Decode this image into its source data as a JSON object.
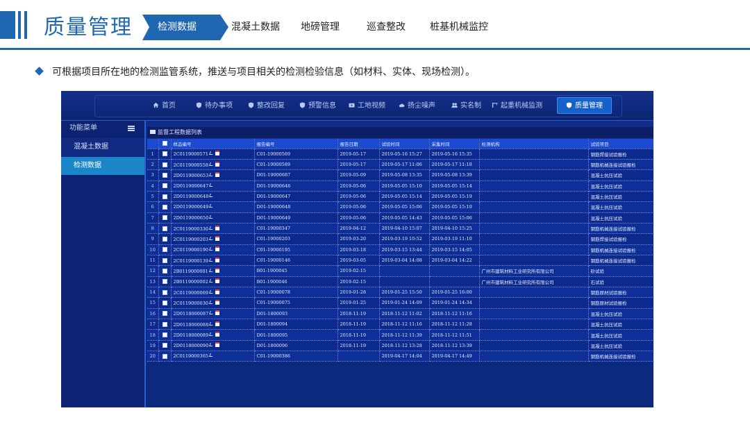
{
  "slide": {
    "title": "质量管理",
    "nav": [
      "检测数据",
      "混凝土数据",
      "地磅管理",
      "巡查整改",
      "桩基机械监控"
    ],
    "bullet": "可根据项目所在地的检测监管系统，推送与项目相关的检测检验信息（如材料、实体、现场检测）。",
    "colors": {
      "brand": "#1f67b1"
    }
  },
  "app": {
    "top_nav": [
      {
        "label": "首页",
        "icon": "home-icon"
      },
      {
        "label": "待办事项",
        "icon": "shield-icon"
      },
      {
        "label": "整改回复",
        "icon": "shield-icon"
      },
      {
        "label": "预警信息",
        "icon": "shield-icon"
      },
      {
        "label": "工地视频",
        "icon": "video-icon"
      },
      {
        "label": "扬尘噪声",
        "icon": "cloud-icon"
      },
      {
        "label": "实名制",
        "icon": "people-icon"
      },
      {
        "label": "起重机械监测",
        "icon": "crane-icon"
      },
      {
        "label": "质量管理",
        "icon": "shield-icon"
      }
    ],
    "sidebar": {
      "title": "功能菜单",
      "items": [
        "混凝土数据",
        "检测数据"
      ]
    },
    "grid": {
      "title": "监督工程数据列表",
      "columns": [
        "样品编号",
        "报告编号",
        "报告日期",
        "试验时间",
        "采集时间",
        "检测机构",
        "试验项目"
      ],
      "rows": [
        {
          "num": "1",
          "sample": "2C0119000571",
          "doc": true,
          "report": "C01-19000569",
          "rdate": "2019-05-17",
          "test": "2019-05-16 15:27",
          "collect": "2019-05-16 15:35",
          "org": "",
          "item": "钢筋焊接试验报检"
        },
        {
          "num": "2",
          "sample": "2C0119000558",
          "doc": true,
          "report": "C01-19000589",
          "rdate": "2019-05-17",
          "test": "2019-05-17 11:06",
          "collect": "2019-05-17 11:18",
          "org": "",
          "item": "钢筋机械连接试验报检"
        },
        {
          "num": "3",
          "sample": "2D0119000653",
          "doc": true,
          "report": "D01-19000687",
          "rdate": "2019-05-09",
          "test": "2019-05-08 13:35",
          "collect": "2019-05-08 13:39",
          "org": "",
          "item": "混凝土抗压试验"
        },
        {
          "num": "4",
          "sample": "2D0119000647",
          "doc": false,
          "report": "D01-19000646",
          "rdate": "2019-05-06",
          "test": "2019-05-05 15:10",
          "collect": "2019-05-05 15:14",
          "org": "",
          "item": "混凝土抗压试验"
        },
        {
          "num": "5",
          "sample": "2D0119000648",
          "doc": false,
          "report": "D01-19000647",
          "rdate": "2019-05-06",
          "test": "2019-05-05 15:14",
          "collect": "2019-05-05 15:19",
          "org": "",
          "item": "混凝土抗压试验"
        },
        {
          "num": "6",
          "sample": "2D0119000649",
          "doc": false,
          "report": "D01-19000648",
          "rdate": "2019-05-06",
          "test": "2019-05-05 15:06",
          "collect": "2019-05-05 15:10",
          "org": "",
          "item": "混凝土抗压试验"
        },
        {
          "num": "7",
          "sample": "2D0119000650",
          "doc": false,
          "report": "D01-19000649",
          "rdate": "2019-05-06",
          "test": "2019-05-05 14:43",
          "collect": "2019-05-05 15:06",
          "org": "",
          "item": "混凝土抗压试验"
        },
        {
          "num": "8",
          "sample": "2C0119000330",
          "doc": true,
          "report": "C01-19000347",
          "rdate": "2019-04-12",
          "test": "2019-04-10 15:07",
          "collect": "2019-04-10 15:25",
          "org": "",
          "item": "钢筋机械连接试验报检"
        },
        {
          "num": "9",
          "sample": "2C0119000203",
          "doc": true,
          "report": "C01-19000203",
          "rdate": "2019-03-20",
          "test": "2019-03-19 10:52",
          "collect": "2019-03-19 11:10",
          "org": "",
          "item": "钢筋焊接试验报检"
        },
        {
          "num": "10",
          "sample": "2C0119000190",
          "doc": true,
          "report": "C01-19000195",
          "rdate": "2019-03-18",
          "test": "2019-03-15 13:44",
          "collect": "2019-03-15 14:05",
          "org": "",
          "item": "钢筋机械连接试验报检"
        },
        {
          "num": "11",
          "sample": "2C0119000139",
          "doc": true,
          "report": "C01-19000146",
          "rdate": "2019-03-05",
          "test": "2019-03-04 14:08",
          "collect": "2019-03-04 14:22",
          "org": "",
          "item": "钢筋机械连接试验报检"
        },
        {
          "num": "12",
          "sample": "2B0119000001",
          "doc": true,
          "report": "B01-1900045",
          "rdate": "2019-02-15",
          "test": "",
          "collect": "",
          "org": "广州市建筑材料工业研究所有限公司",
          "item": "砂试验"
        },
        {
          "num": "13",
          "sample": "2B0119000002",
          "doc": true,
          "report": "B01-1900046",
          "rdate": "2019-02-15",
          "test": "",
          "collect": "",
          "org": "广州市建筑材料工业研究所有限公司",
          "item": "石试验"
        },
        {
          "num": "14",
          "sample": "2C0119000069",
          "doc": true,
          "report": "C01-19000078",
          "rdate": "2019-01-28",
          "test": "2019-01-25 15:50",
          "collect": "2019-01-25 16:00",
          "org": "",
          "item": "钢筋原材试验报检"
        },
        {
          "num": "15",
          "sample": "2C0119000030",
          "doc": true,
          "report": "C01-19000075",
          "rdate": "2019-01-25",
          "test": "2019-01-24 14:09",
          "collect": "2019-01-24 14:34",
          "org": "",
          "item": "钢筋原材试验报检"
        },
        {
          "num": "16",
          "sample": "2D0118000087",
          "doc": true,
          "report": "D01-1800093",
          "rdate": "2018-11-19",
          "test": "2018-11-12 11:02",
          "collect": "2018-11-12 11:16",
          "org": "",
          "item": "混凝土抗压试验"
        },
        {
          "num": "17",
          "sample": "2D0118000088",
          "doc": true,
          "report": "D01-1800094",
          "rdate": "2018-11-19",
          "test": "2018-11-12 11:16",
          "collect": "2018-11-12 11:28",
          "org": "",
          "item": "混凝土抗压试验"
        },
        {
          "num": "18",
          "sample": "2D0118000089",
          "doc": true,
          "report": "D01-1800095",
          "rdate": "2018-11-19",
          "test": "2018-11-12 11:39",
          "collect": "2018-11-12 11:51",
          "org": "",
          "item": "混凝土抗压试验"
        },
        {
          "num": "19",
          "sample": "2D0118000090",
          "doc": true,
          "report": "D01-1800096",
          "rdate": "2018-11-19",
          "test": "2018-11-12 13:28",
          "collect": "2018-11-12 13:39",
          "org": "",
          "item": "混凝土抗压试验"
        },
        {
          "num": "20",
          "sample": "2C0119000365",
          "doc": false,
          "report": "C01-19000386",
          "rdate": "",
          "test": "2019-04-17 14:04",
          "collect": "2019-04-17 14:49",
          "org": "",
          "item": "钢筋机械连接试验报检"
        }
      ]
    },
    "colors": {
      "active_nav": "#1660c9",
      "active_side": "#1a86c9",
      "header_row": "#1c4ad0",
      "panel": "#0c2a8e"
    }
  }
}
